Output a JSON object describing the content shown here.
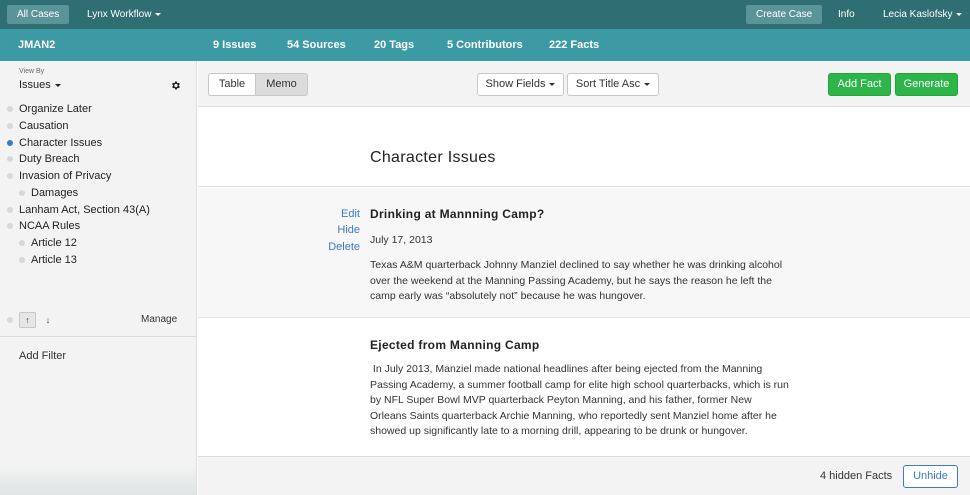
{
  "topbar": {
    "all_cases": "All Cases",
    "workflow": "Lynx Workflow",
    "create_case": "Create Case",
    "info": "Info",
    "user": "Lecia Kaslofsky"
  },
  "stats": {
    "case_name": "JMAN2",
    "issues": "9 Issues",
    "sources": "54 Sources",
    "tags": "20 Tags",
    "contributors": "5 Contributors",
    "facts": "222 Facts"
  },
  "sidebar": {
    "view_by_label": "View By",
    "view_by_value": "Issues",
    "issues": [
      {
        "label": "Organize Later",
        "selected": false
      },
      {
        "label": "Causation",
        "selected": false
      },
      {
        "label": "Character Issues",
        "selected": true
      },
      {
        "label": "Duty Breach",
        "selected": false
      },
      {
        "label": "Invasion of Privacy",
        "selected": false
      },
      {
        "label": "Damages",
        "selected": false
      },
      {
        "label": "Lanham Act, Section 43(A)",
        "selected": false
      },
      {
        "label": "NCAA Rules",
        "selected": false
      },
      {
        "label": "Article 12",
        "selected": false
      },
      {
        "label": "Article 13",
        "selected": false
      }
    ],
    "manage": "Manage",
    "add_filter": "Add Filter"
  },
  "toolbar": {
    "table": "Table",
    "memo": "Memo",
    "show_fields": "Show Fields",
    "sort": "Sort Title Asc",
    "add_fact": "Add Fact",
    "generate": "Generate"
  },
  "content": {
    "title": "Character Issues",
    "facts": [
      {
        "title": "Drinking at Mannning Camp?",
        "date": "July 17, 2013",
        "body": "Texas A&M quarterback Johnny Manziel declined to say whether he was drinking alcohol over the weekend at the Manning Passing Academy, but he says the reason he left the camp early was “absolutely not” because he was hungover.",
        "edit": "Edit",
        "hide": "Hide",
        "delete": "Delete"
      },
      {
        "title": "Ejected from Manning Camp",
        "body": " In July 2013, Manziel made national headlines after being ejected from the Manning Passing Academy, a summer football camp for elite high school quarterbacks, which is run by NFL Super Bowl MVP quarterback Peyton Manning, and his father, former New Orleans Saints quarterback Archie Manning, who reportedly sent Manziel home after he showed up significantly late to a morning drill, appearing to be drunk or hungover."
      }
    ],
    "hidden_facts": "4 hidden Facts",
    "unhide": "Unhide"
  },
  "colors": {
    "topbar": "#2f6e73",
    "statsbar": "#3b9aa3",
    "accent_green": "#2db54a",
    "link_blue": "#3a7cc4"
  }
}
